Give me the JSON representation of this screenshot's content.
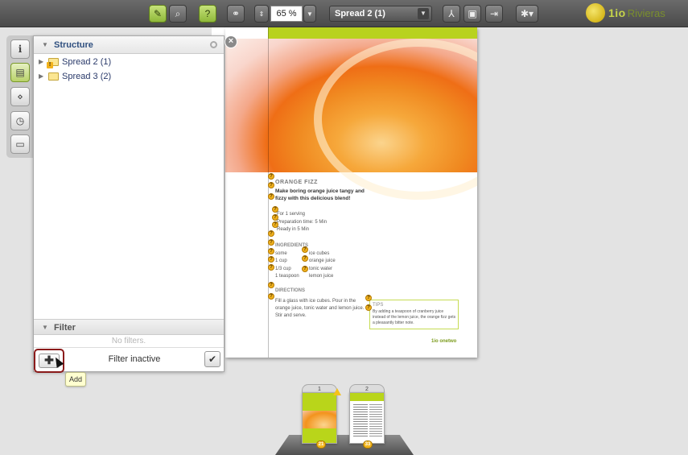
{
  "toolbar": {
    "zoom_value": "65 %",
    "spread_select": "Spread 2 (1)",
    "logo_text": "1io",
    "logo_text2": "Rivieras",
    "accent_color": "#9bc13a"
  },
  "rail": {
    "items": [
      {
        "name": "info",
        "glyph": "i"
      },
      {
        "name": "structure",
        "glyph": "▤"
      },
      {
        "name": "connections",
        "glyph": "⋄"
      },
      {
        "name": "history",
        "glyph": "◷"
      },
      {
        "name": "comments",
        "glyph": "▭"
      }
    ]
  },
  "panel": {
    "structure_title": "Structure",
    "tree": [
      {
        "label": "Spread 2 (1)",
        "warning": true
      },
      {
        "label": "Spread 3 (2)",
        "warning": false
      }
    ],
    "filter_title": "Filter",
    "no_filters": "No filters.",
    "filter_state": "Filter inactive",
    "add_symbol": "✚",
    "check_symbol": "✔",
    "tooltip": "Add"
  },
  "document": {
    "recipe_title": "ORANGE FIZZ",
    "recipe_sub": "Make boring orange juice tangy and fizzy with this delicious blend!",
    "meta": [
      "For 1 serving",
      "Preparation time: 5 Min",
      "Ready in 5 Min"
    ],
    "ingredients_title": "INGREDIENTS",
    "ingredients": [
      {
        "qty": "some",
        "item": "ice cubes"
      },
      {
        "qty": "1 cup",
        "item": "orange juice"
      },
      {
        "qty": "1/3 cup",
        "item": "tonic water"
      },
      {
        "qty": "1 teaspoon",
        "item": "lemon juice"
      }
    ],
    "directions_title": "DIRECTIONS",
    "directions": "Fill a glass with ice cubes. Pour in the orange juice, tonic water and lemon juice. Stir and serve.",
    "tips_title": "TIPS",
    "tips": "By adding a teaspoon of cranberry juice instead of the lemon juice, the orange fizz gets a pleasantly bitter note.",
    "footer_logo": "1io onetwo"
  },
  "spreads": [
    {
      "number": "1",
      "badge": "21"
    },
    {
      "number": "2",
      "badge": "33"
    }
  ]
}
